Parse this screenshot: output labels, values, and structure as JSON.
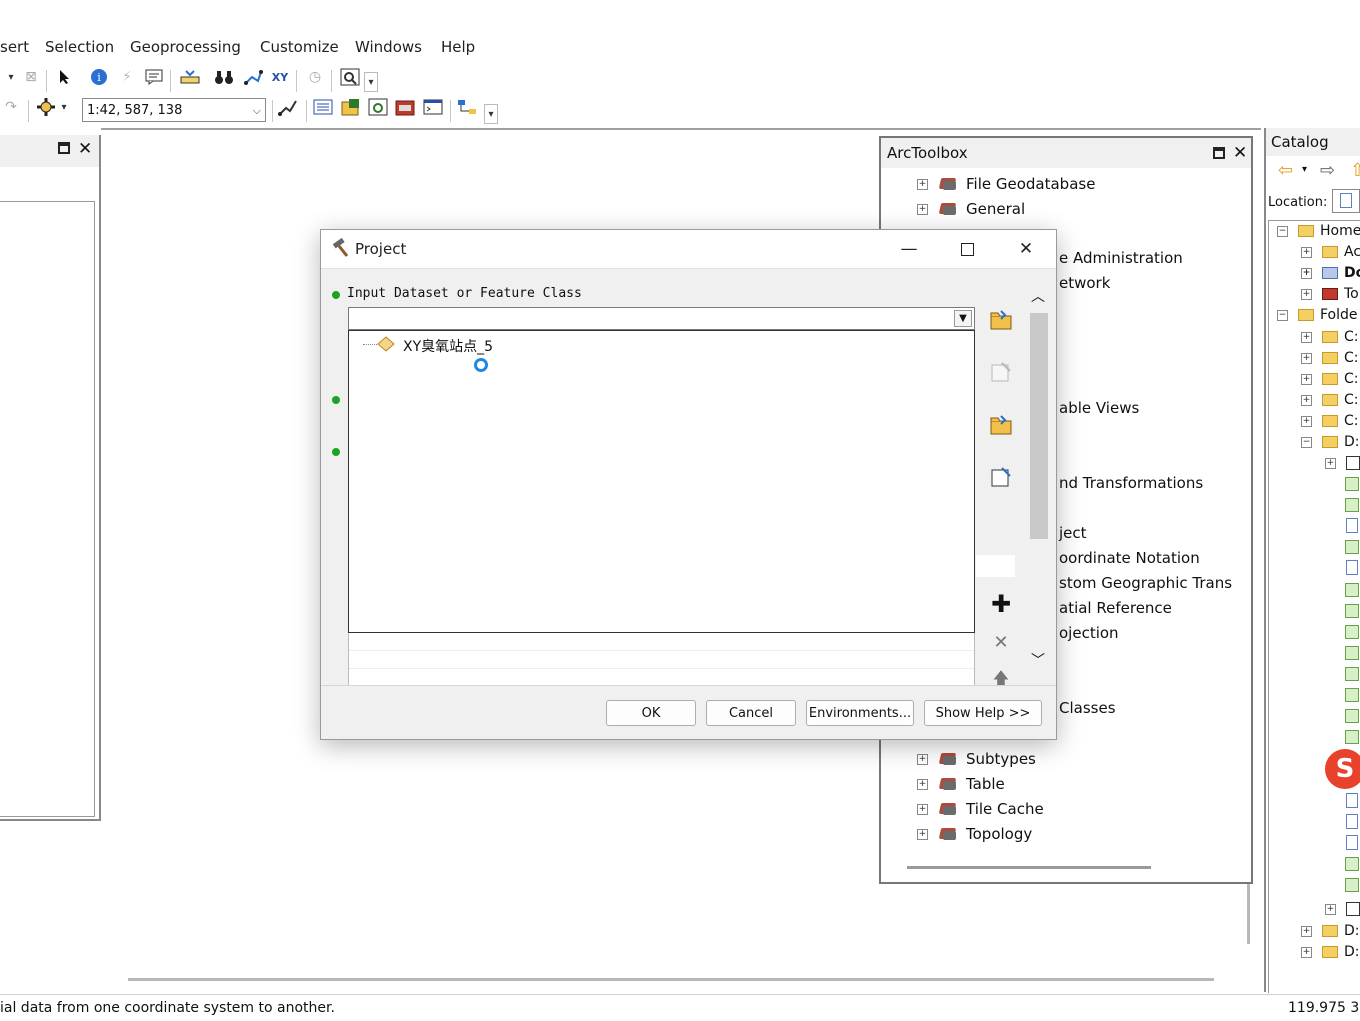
{
  "menu": [
    "sert",
    "Selection",
    "Geoprocessing",
    "Customize",
    "Windows",
    "Help"
  ],
  "toolbar": {
    "scale": "1:42, 587, 138"
  },
  "arctoolbox": {
    "title": "ArcToolbox",
    "items_full": [
      "File Geodatabase",
      "General",
      "Subtypes",
      "Table",
      "Tile Cache",
      "Topology"
    ],
    "items_partial": [
      "e Administration",
      "etwork",
      "able Views",
      "nd Transformations",
      "ject",
      "oordinate Notation",
      "stom Geographic Trans",
      "atial Reference",
      "ojection",
      "Classes"
    ]
  },
  "catalog": {
    "title": "Catalog",
    "location_label": "Location:",
    "rows": [
      "Home",
      "Ac",
      "Do",
      "To",
      "Folde",
      "C:",
      "C:",
      "C:",
      "C:",
      "C:",
      "D:",
      "D:",
      "D:"
    ]
  },
  "dialog": {
    "title": "Project",
    "input_label": "Input Dataset or Feature Class",
    "dropdown_item": "XY臭氧站点_5",
    "buttons": {
      "ok": "OK",
      "cancel": "Cancel",
      "environments": "Environments...",
      "help": "Show Help >>"
    }
  },
  "status": {
    "message": "ial data from one coordinate system to another.",
    "coords": "119.975  3"
  }
}
